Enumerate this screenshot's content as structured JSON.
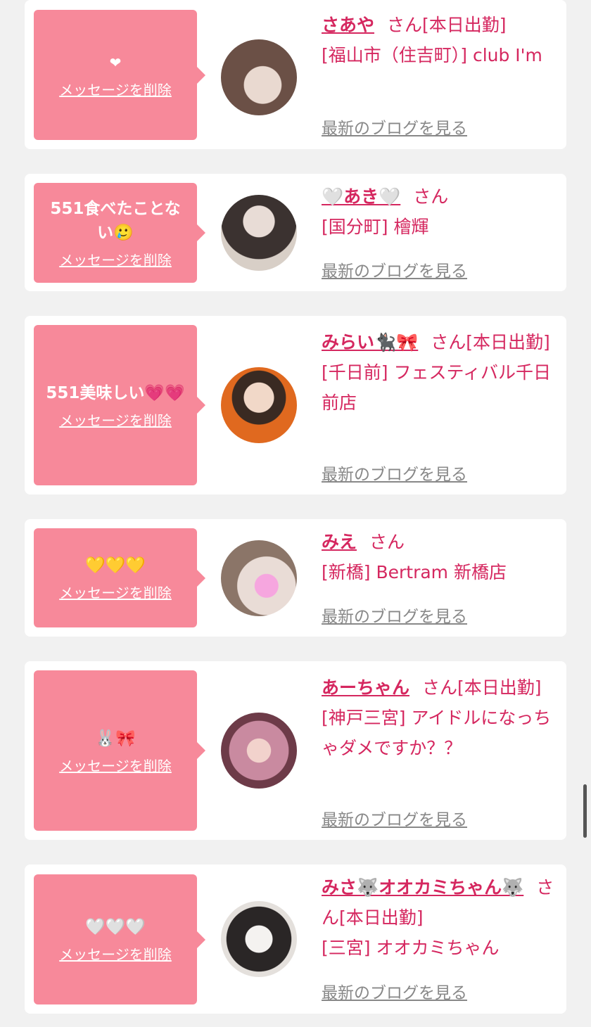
{
  "cards": [
    {
      "message": "❤",
      "delete_label": "メッセージを削除",
      "name": "さあや",
      "san": "さん",
      "suffix": "[本日出勤]",
      "location": "[福山市（住吉町）] club I'm",
      "blog_label": "最新のブログを見る",
      "avatar_colors": [
        "#6b5046",
        "#c9b6aa"
      ]
    },
    {
      "message": "551食べたことない🥲",
      "delete_label": "メッセージを削除",
      "name": "🤍あき🤍",
      "san": "さん",
      "suffix": "",
      "location": "[国分町] 檜輝",
      "blog_label": "最新のブログを見る",
      "avatar_colors": [
        "#3b3230",
        "#d8cfc7"
      ]
    },
    {
      "message": "551美味しい💗💗",
      "delete_label": "メッセージを削除",
      "name": "みらい🐈‍⬛🎀",
      "san": "さん",
      "suffix": "[本日出勤]",
      "location": "[千日前] フェスティバル千日前店",
      "blog_label": "最新のブログを見る",
      "avatar_colors": [
        "#e0691f",
        "#3a2a22"
      ]
    },
    {
      "message": "💛💛💛",
      "delete_label": "メッセージを削除",
      "name": "みえ",
      "san": "さん",
      "suffix": "",
      "location": "[新橋] Bertram 新橋店",
      "blog_label": "最新のブログを見る",
      "avatar_colors": [
        "#d9d3cf",
        "#8b7568"
      ]
    },
    {
      "message": "🐰🎀",
      "delete_label": "メッセージを削除",
      "name": "あーちゃん",
      "san": "さん",
      "suffix": "[本日出勤]",
      "location": "[神戸三宮] アイドルになっちゃダメですか？？",
      "blog_label": "最新のブログを見る",
      "avatar_colors": [
        "#c98aa0",
        "#6d3b48"
      ]
    },
    {
      "message": "🤍🤍🤍",
      "delete_label": "メッセージを削除",
      "name": "みさ🐺オオカミちゃん🐺",
      "san": "さん",
      "suffix": "[本日出勤]",
      "location": "[三宮] オオカミちゃん",
      "blog_label": "最新のブログを見る",
      "avatar_colors": [
        "#e4e0dc",
        "#2a2626"
      ]
    }
  ]
}
